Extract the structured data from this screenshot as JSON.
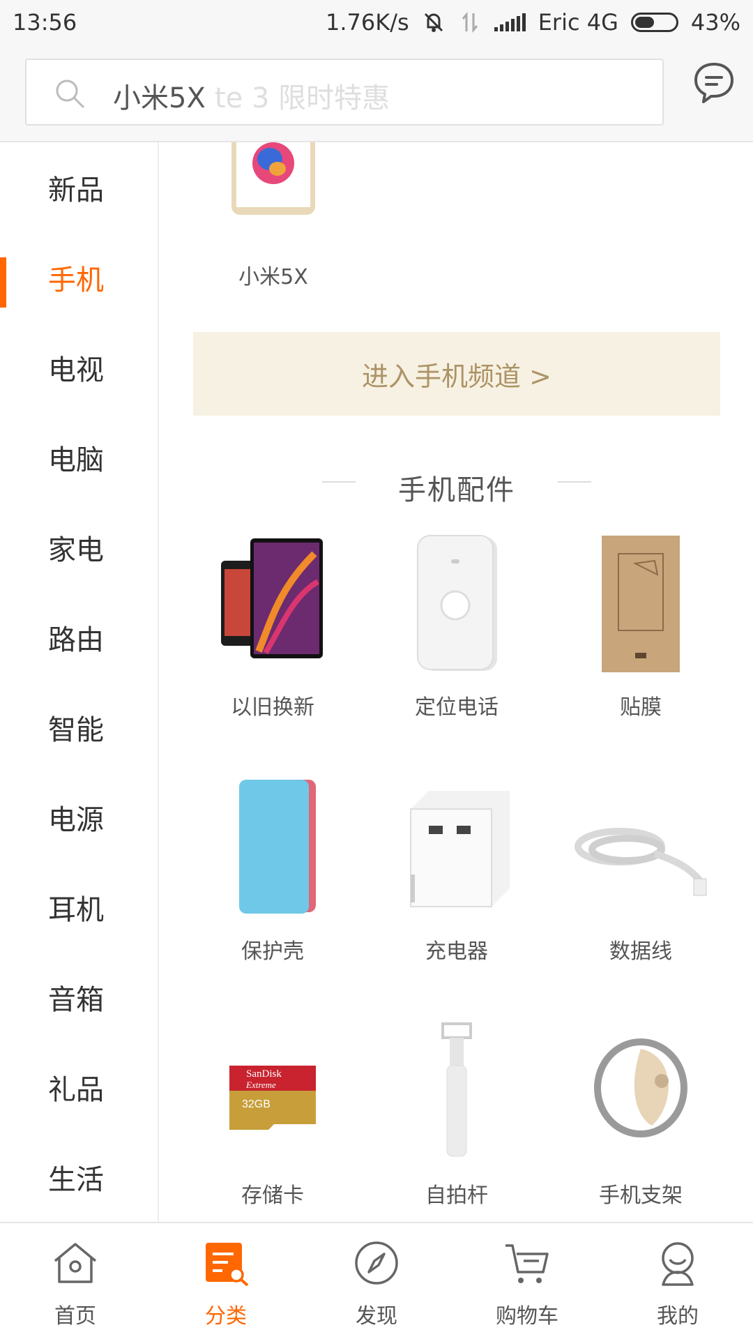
{
  "status": {
    "time": "13:56",
    "speed": "1.76K/s",
    "carrier": "Eric 4G",
    "battery": "43%",
    "battery_level": 0.43
  },
  "search": {
    "current_text": "小米5X",
    "placeholder_fragment": "te 3 限时特惠"
  },
  "icons": {
    "search": "search-icon",
    "message": "message-icon"
  },
  "sidebar": {
    "items": [
      {
        "label": "新品"
      },
      {
        "label": "手机"
      },
      {
        "label": "电视"
      },
      {
        "label": "电脑"
      },
      {
        "label": "家电"
      },
      {
        "label": "路由"
      },
      {
        "label": "智能"
      },
      {
        "label": "电源"
      },
      {
        "label": "耳机"
      },
      {
        "label": "音箱"
      },
      {
        "label": "礼品"
      },
      {
        "label": "生活"
      }
    ],
    "active": "手机"
  },
  "main": {
    "top_product": {
      "label": "小米5X"
    },
    "channel_button": "进入手机频道 >",
    "section_title": "手机配件",
    "accessories": [
      {
        "label": "以旧换新",
        "icon": "phones-image"
      },
      {
        "label": "定位电话",
        "icon": "locator-phone-image"
      },
      {
        "label": "贴膜",
        "icon": "screen-film-image"
      },
      {
        "label": "保护壳",
        "icon": "phone-case-image"
      },
      {
        "label": "充电器",
        "icon": "charger-image"
      },
      {
        "label": "数据线",
        "icon": "cable-image"
      },
      {
        "label": "存储卡",
        "icon": "memory-card-image"
      },
      {
        "label": "自拍杆",
        "icon": "selfie-stick-image"
      },
      {
        "label": "手机支架",
        "icon": "ring-holder-image"
      }
    ],
    "memory_card_brand": "SanDisk",
    "memory_card_line": "Extreme",
    "memory_card_capacity": "32GB"
  },
  "bottom_nav": {
    "items": [
      {
        "label": "首页",
        "icon": "home-icon"
      },
      {
        "label": "分类",
        "icon": "category-icon"
      },
      {
        "label": "发现",
        "icon": "compass-icon"
      },
      {
        "label": "购物车",
        "icon": "cart-icon"
      },
      {
        "label": "我的",
        "icon": "profile-icon"
      }
    ],
    "active": "分类"
  },
  "colors": {
    "accent": "#ff6700",
    "channel_bg": "#f6f1e2",
    "channel_text": "#ad9366"
  }
}
